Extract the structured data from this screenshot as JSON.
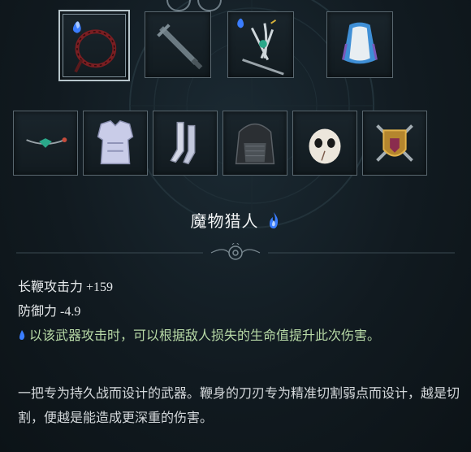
{
  "item": {
    "name": "魔物猎人",
    "rarity_color": "#3a7dff",
    "stats": [
      {
        "label": "长鞭攻击力 +159"
      },
      {
        "label": "防御力 -4.9"
      }
    ],
    "passive_text": "以该武器攻击时，可以根据敌人损失的生命值提升此次伤害。",
    "description": "一把专为持久战而设计的武器。鞭身的刀刃专为精准切割弱点而设计，越是切割，便越是能造成更深重的伤害。"
  },
  "equipment_slots": {
    "row1": [
      {
        "icon": "thorn-whip-icon",
        "selected": true
      },
      {
        "icon": "sword-icon",
        "selected": false
      },
      {
        "icon": "ornate-spear-icon",
        "selected": false
      },
      {
        "icon": "cape-icon",
        "selected": false
      }
    ],
    "row2": [
      {
        "icon": "necklace-icon",
        "selected": false
      },
      {
        "icon": "armor-icon",
        "selected": false
      },
      {
        "icon": "boots-icon",
        "selected": false
      },
      {
        "icon": "hood-icon",
        "selected": false
      },
      {
        "icon": "mask-icon",
        "selected": false
      },
      {
        "icon": "crossed-swords-shield-icon",
        "selected": false
      }
    ]
  },
  "colors": {
    "passive_text": "#b7d9a6",
    "background": "#111a20",
    "slot_border": "#5a6870"
  }
}
